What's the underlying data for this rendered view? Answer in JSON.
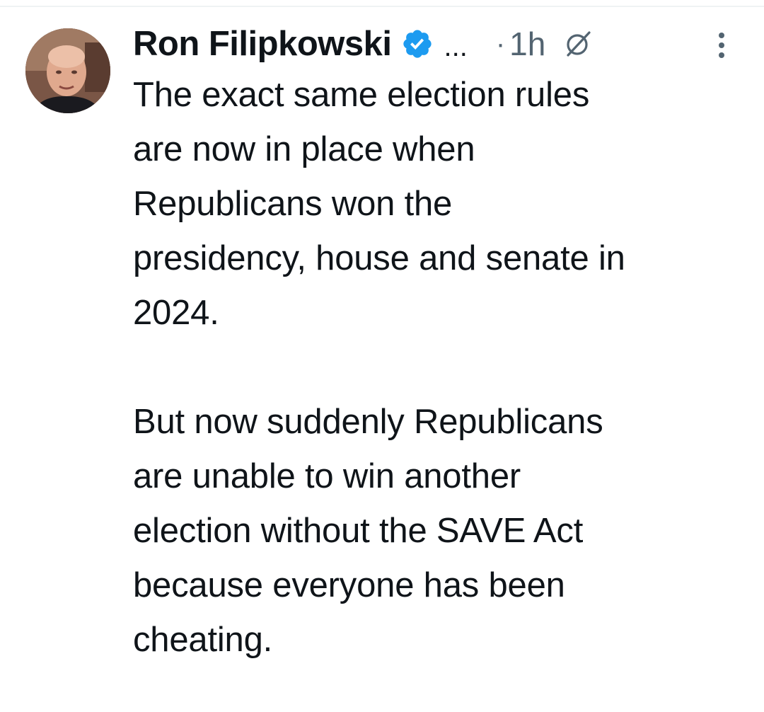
{
  "tweet": {
    "author": {
      "name": "Ron Filipkowski",
      "verified_icon": "verified-badge-icon",
      "truncation": "..."
    },
    "separator": "·",
    "timestamp": "1h",
    "grok_icon": "grok-icon",
    "more_icon": "more-options-icon",
    "body": "The exact same election rules\nare now in place when\nRepublicans won the\npresidency, house and senate in\n2024.\n\nBut now suddenly Republicans\nare unable to win another\nelection without the SAVE Act\nbecause everyone has been\ncheating."
  },
  "colors": {
    "text_primary": "#0f1419",
    "text_secondary": "#536471",
    "verified_blue": "#1d9bf0",
    "divider": "#eff3f4"
  }
}
